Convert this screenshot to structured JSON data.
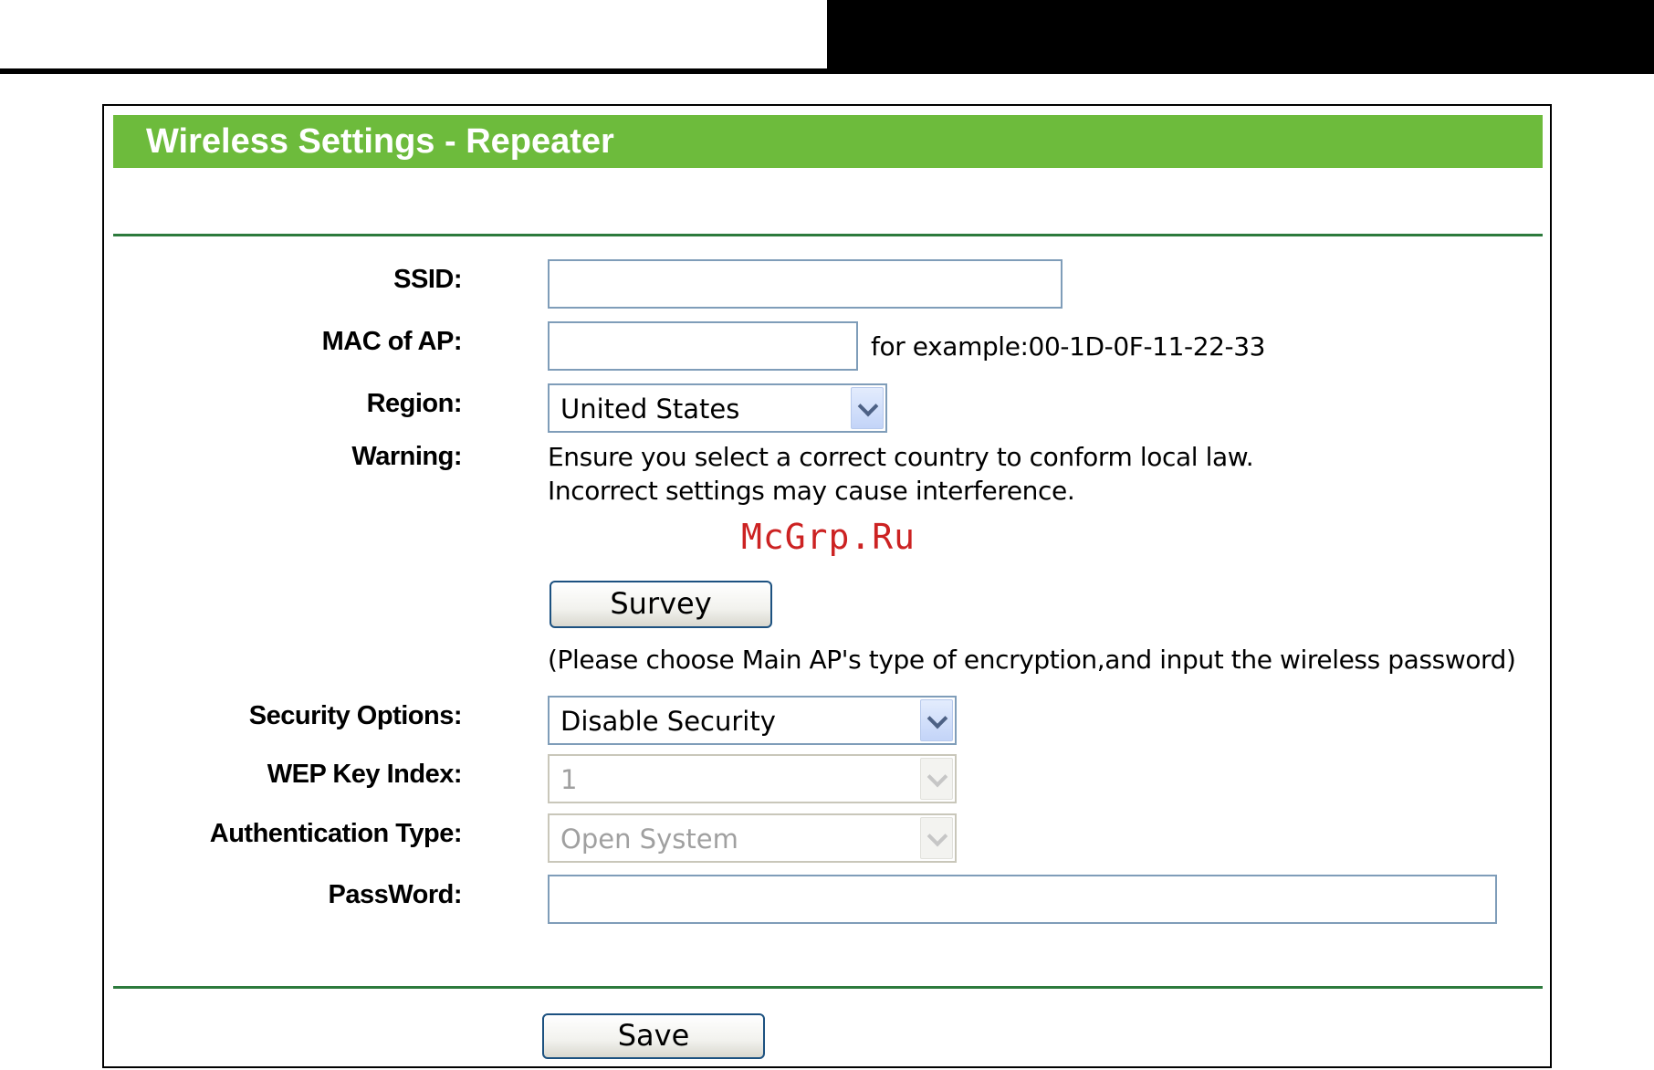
{
  "page": {
    "title": "Wireless Settings - Repeater",
    "watermark": "McGrp.Ru"
  },
  "form": {
    "ssid": {
      "label": "SSID:",
      "value": ""
    },
    "mac": {
      "label": "MAC of AP:",
      "value": "",
      "hint": "for example:00-1D-0F-11-22-33"
    },
    "region": {
      "label": "Region:",
      "selected": "United States"
    },
    "warning": {
      "label": "Warning:",
      "line1": "Ensure you select a correct country to conform local law.",
      "line2": "Incorrect settings may cause interference."
    },
    "survey_button": "Survey",
    "note": "(Please choose Main AP's type of encryption,and input the wireless password)",
    "security": {
      "label": "Security Options:",
      "selected": "Disable Security"
    },
    "wep_key_index": {
      "label": "WEP Key Index:",
      "selected": "1",
      "disabled": true
    },
    "auth_type": {
      "label": "Authentication Type:",
      "selected": "Open System",
      "disabled": true
    },
    "password": {
      "label": "PassWord:",
      "value": ""
    },
    "save_button": "Save"
  },
  "colors": {
    "title_bar": "#6dbb3c",
    "divider": "#2c7a3c",
    "input_border": "#7f9db9",
    "watermark": "#cc2222"
  },
  "icons": {
    "dropdown": "chevron-down-icon"
  }
}
